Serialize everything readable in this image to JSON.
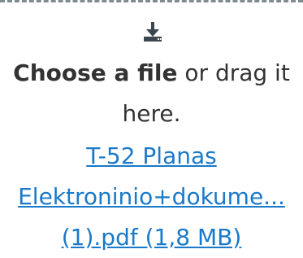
{
  "dropzone": {
    "choose_label": "Choose a file",
    "drag_text": " or drag it here.",
    "icon": "download-tray-icon",
    "accent_color": "#1a79c9",
    "border_color": "#7f8c8d"
  },
  "file": {
    "name_line1": "T-52 Planas",
    "name_line2": "Elektroninio+dokume...",
    "name_line3": "(1).pdf (1,8 MB)"
  }
}
